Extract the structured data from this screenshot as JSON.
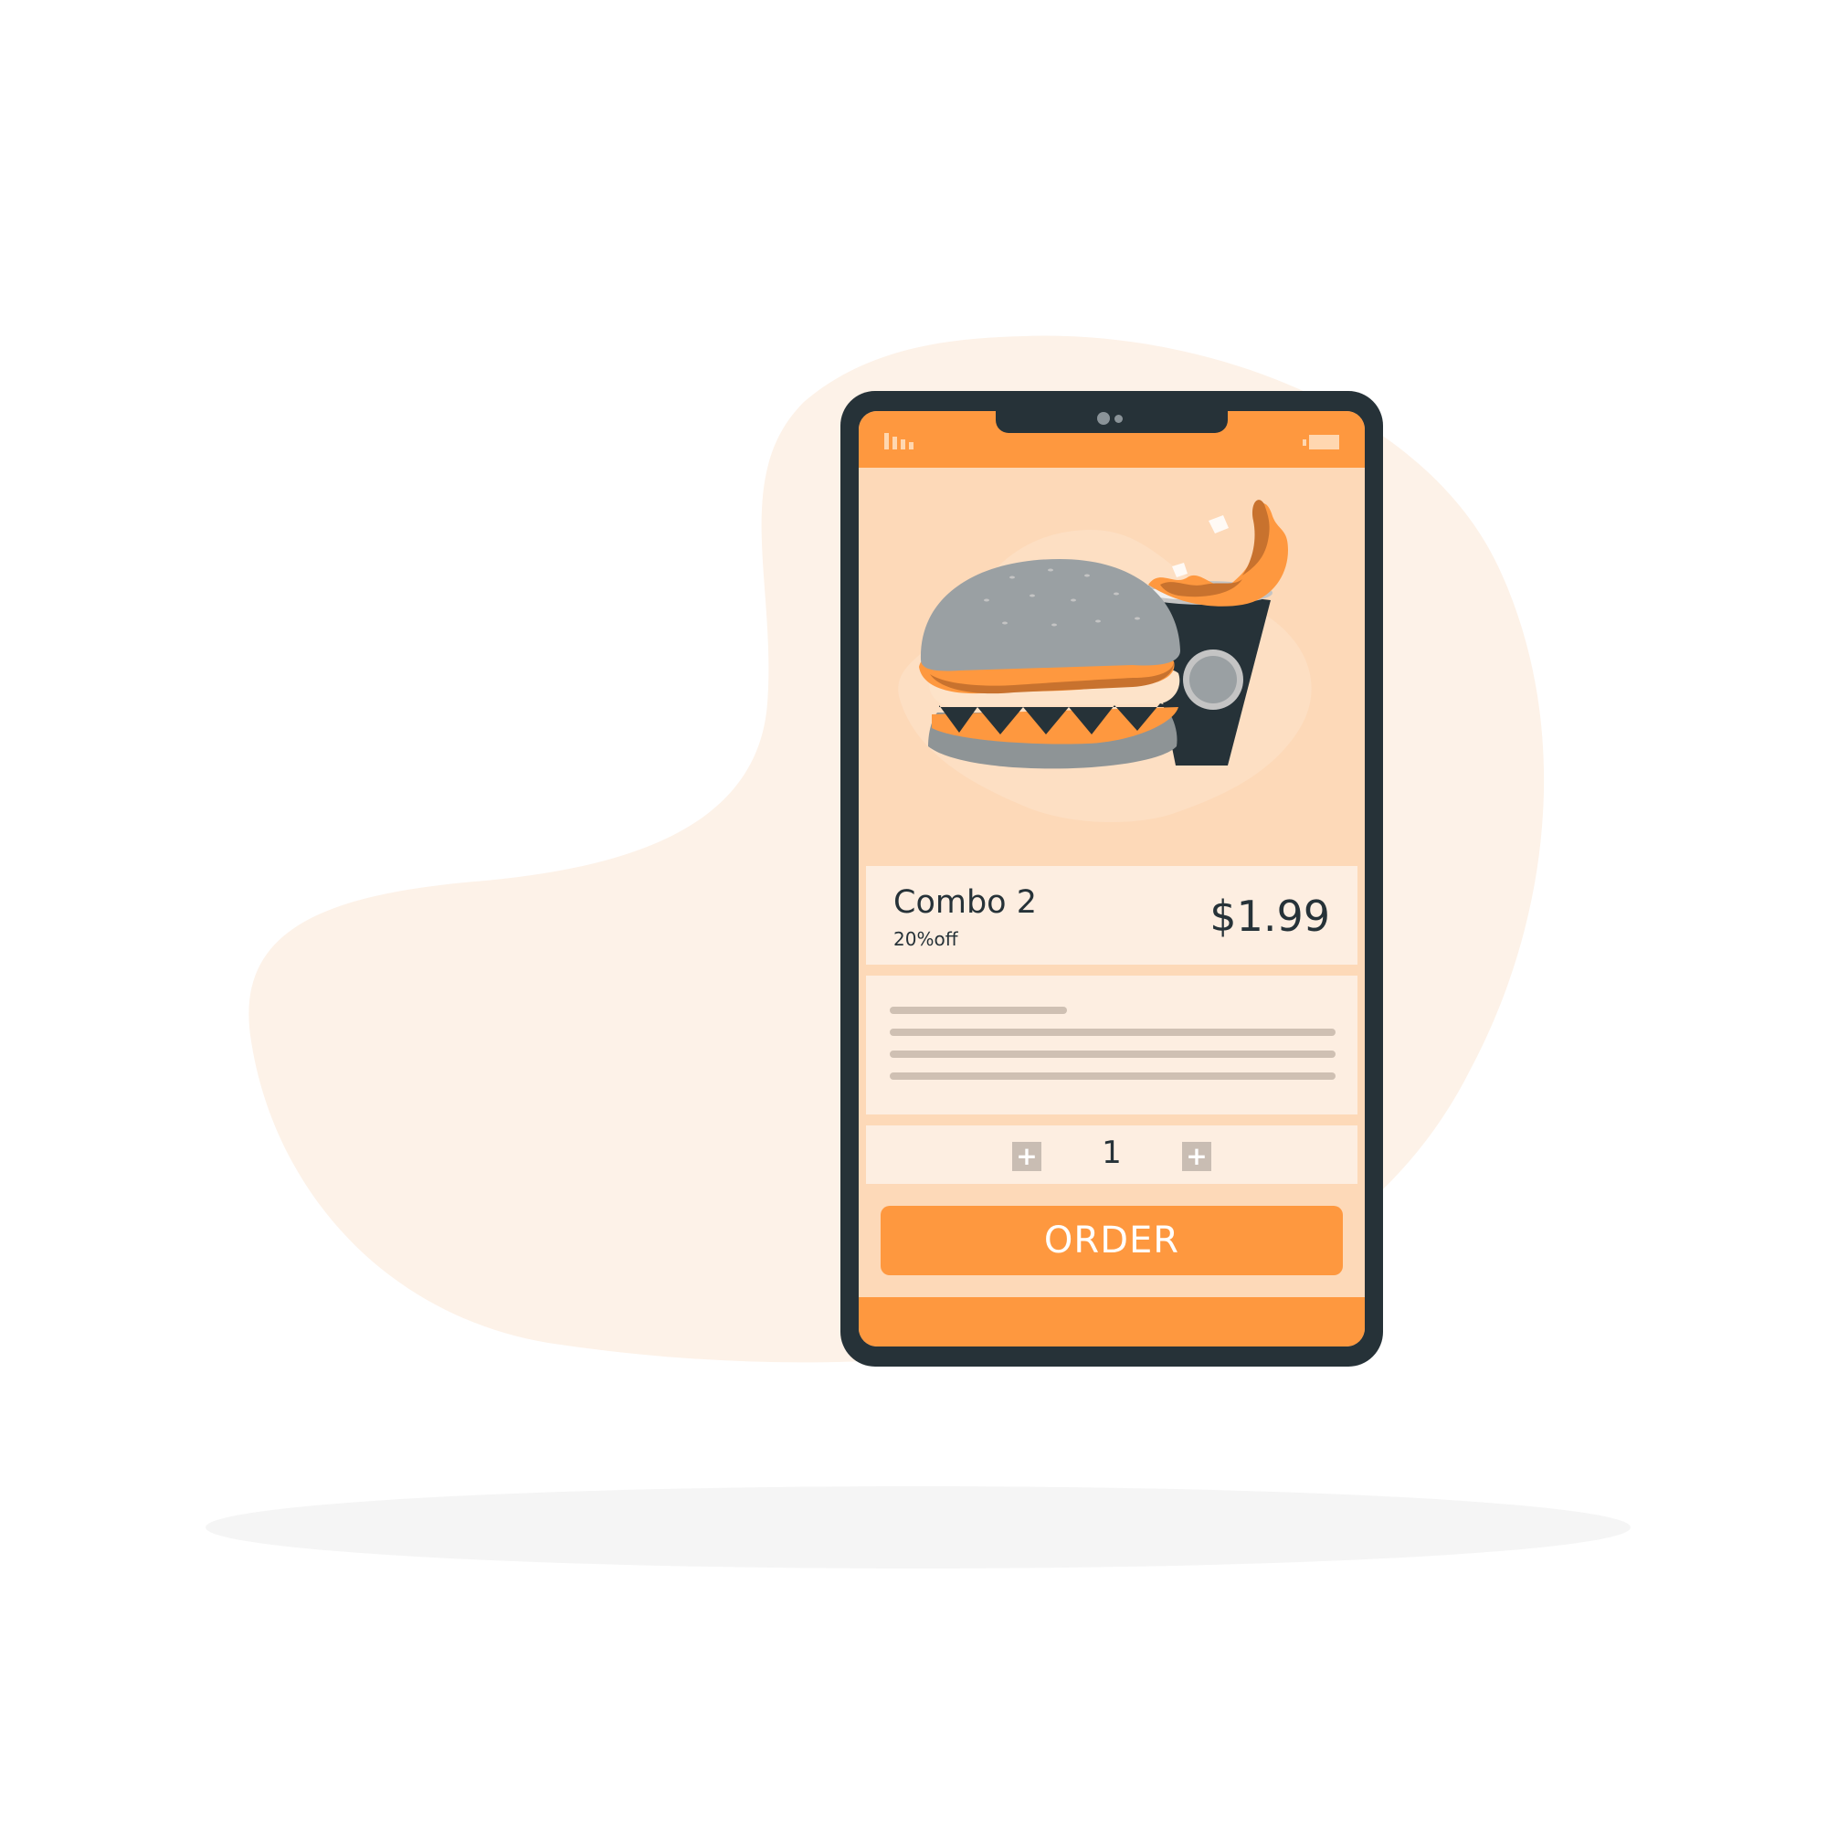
{
  "colors": {
    "accent": "#fe983f",
    "screen_bg": "#fdd9b8",
    "card_bg": "#fdeee1",
    "phone_frame": "#263238",
    "blob_bg": "#fdf2e8"
  },
  "status_bar": {
    "signal_icon": "signal-bars-icon",
    "battery_icon": "battery-icon"
  },
  "product": {
    "image_icon": "burger-and-drink-illustration",
    "name": "Combo 2",
    "discount": "20%off",
    "price": "$1.99"
  },
  "quantity": {
    "decrease_icon": "plus-icon",
    "decrease_label": "+",
    "value": "1",
    "increase_icon": "plus-icon",
    "increase_label": "+"
  },
  "order_button": {
    "label": "ORDER"
  }
}
